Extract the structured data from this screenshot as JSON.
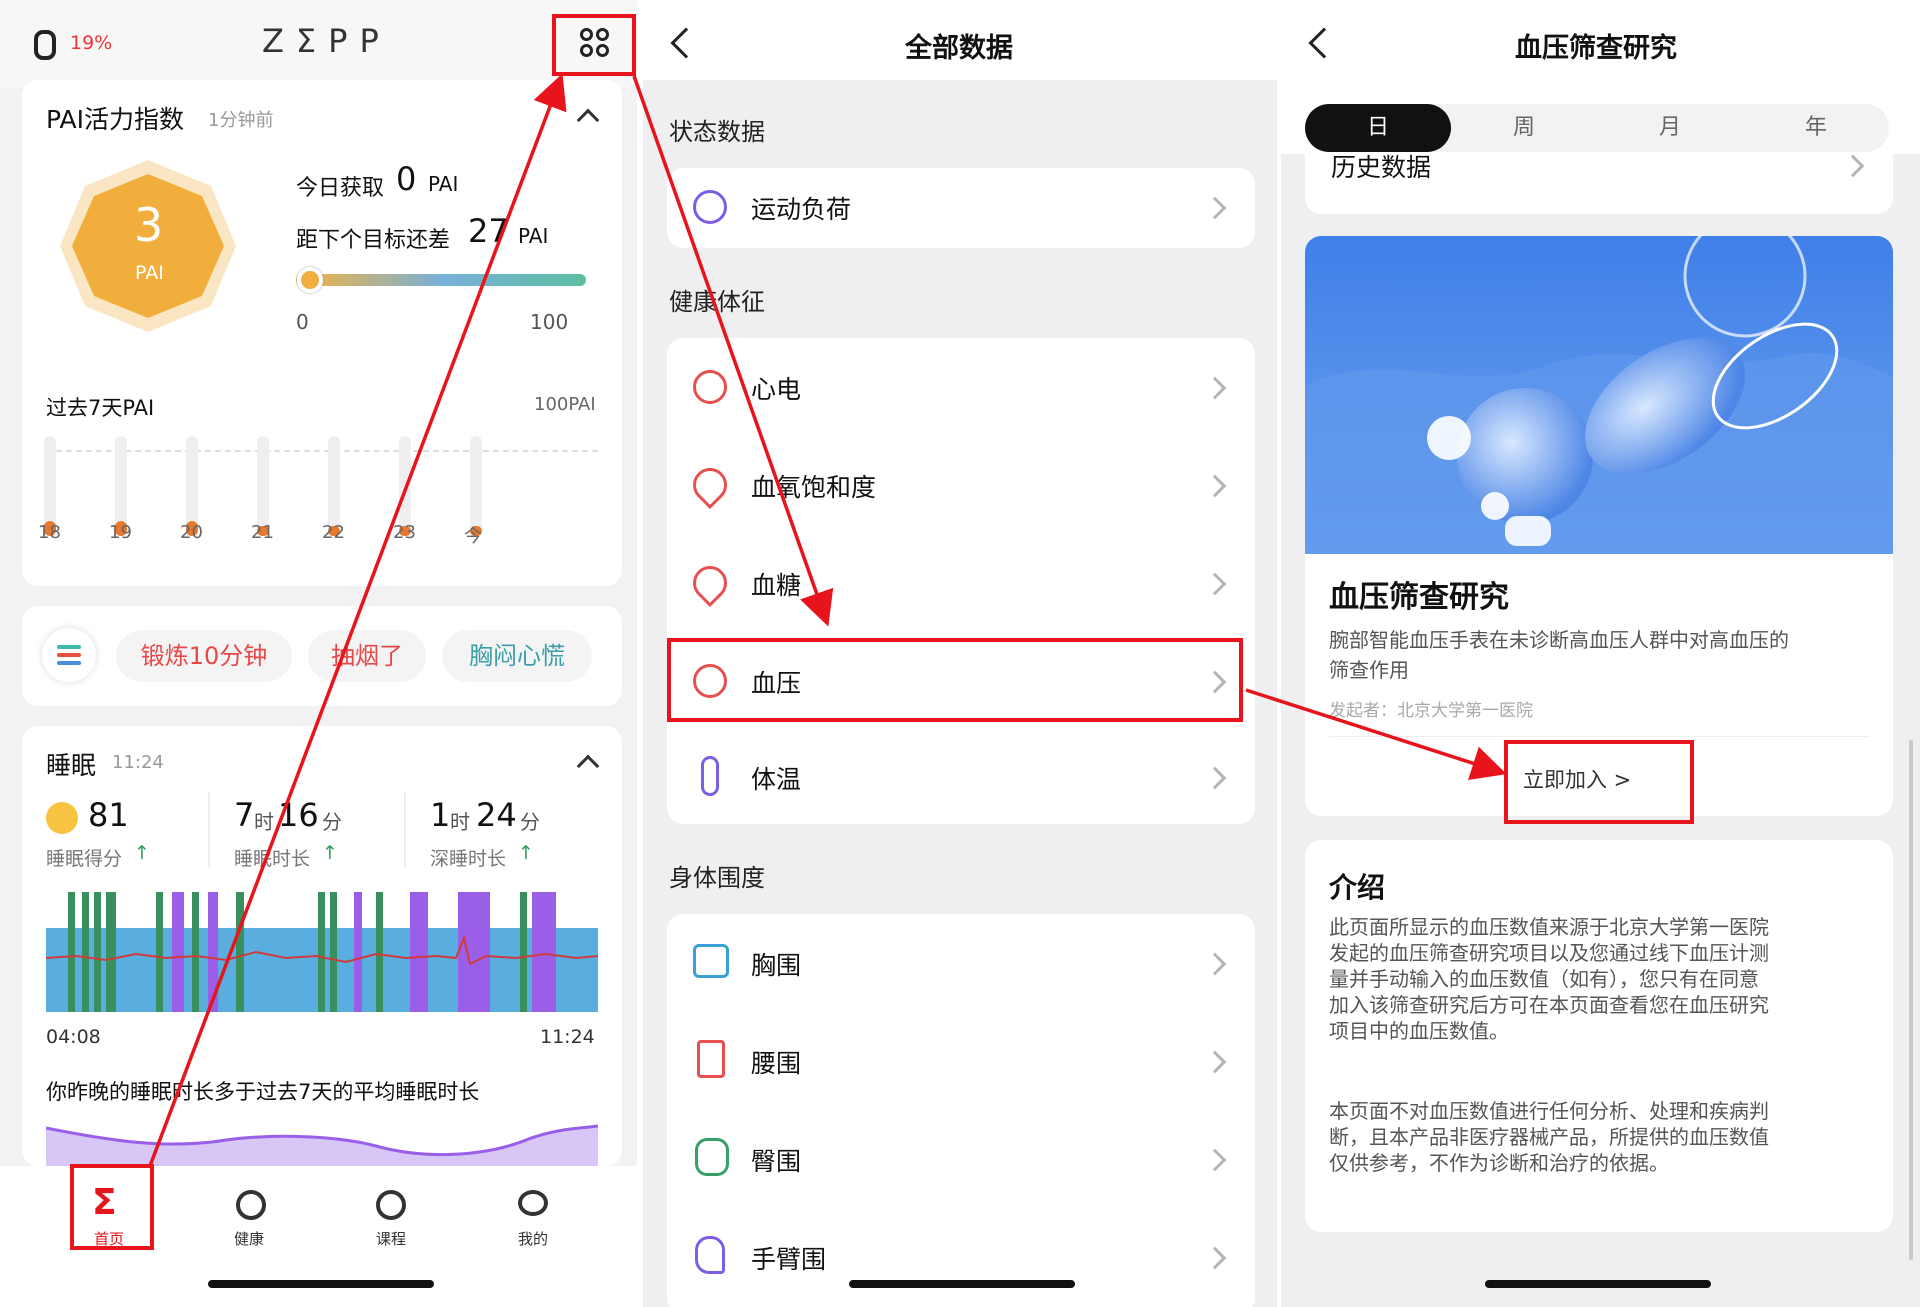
{
  "home": {
    "battery": "19%",
    "brand": "ZΣPP",
    "pai": {
      "title": "PAI活力指数",
      "time": "1分钟前",
      "value": "3",
      "unit": "PAI",
      "today_label": "今日获取",
      "today_value": "0",
      "today_unit": "PAI",
      "remain_label": "距下个目标还差",
      "remain_value": "27",
      "remain_unit": "PAI",
      "progress": 0.03,
      "min": "0",
      "max": "100",
      "week_title": "过去7天PAI",
      "week_max": "100PAI",
      "days": [
        "18",
        "19",
        "20",
        "21",
        "22",
        "23",
        "今"
      ],
      "values": [
        3,
        3,
        3,
        2,
        2,
        2,
        2
      ]
    },
    "tags": [
      "锻炼10分钟",
      "抽烟了",
      "胸闷心慌"
    ],
    "sleep": {
      "title": "睡眠",
      "time": "11:24",
      "score": "81",
      "score_label": "睡眠得分",
      "dur_h": "7",
      "dur_h_unit": "时",
      "dur_m": "16",
      "dur_m_unit": "分",
      "dur_label": "睡眠时长",
      "deep_h": "1",
      "deep_h_unit": "时",
      "deep_m": "24",
      "deep_m_unit": "分",
      "deep_label": "深睡时长",
      "start": "04:08",
      "end": "11:24",
      "note": "你昨晚的睡眠时长多于过去7天的平均睡眠时长"
    },
    "nav": [
      "首页",
      "健康",
      "课程",
      "我的"
    ]
  },
  "all_data": {
    "title": "全部数据",
    "section1": "状态数据",
    "item_load": "运动负荷",
    "section2": "健康体征",
    "vitals": [
      "心电",
      "血氧饱和度",
      "血糖",
      "血压",
      "体温"
    ],
    "section3": "身体围度",
    "body": [
      "胸围",
      "腰围",
      "臀围",
      "手臂围"
    ]
  },
  "bp": {
    "title": "血压筛查研究",
    "tabs": [
      "日",
      "周",
      "月",
      "年"
    ],
    "history": "历史数据",
    "study_title": "血压筛查研究",
    "study_desc_1": "腕部智能血压手表在未诊断高血压人群中对高血压的",
    "study_desc_2": "筛查作用",
    "sponsor": "发起者：北京大学第一医院",
    "join": "立即加入 >",
    "intro_title": "介绍",
    "intro_p1": [
      "此页面所显示的血压数值来源于北京大学第一医院",
      "发起的血压筛查研究项目以及您通过线下血压计测",
      "量并手动输入的血压数值（如有），您只有在同意",
      "加入该筛查研究后方可在本页面查看您在血压研究",
      "项目中的血压数值。"
    ],
    "intro_p2": [
      "本页面不对血压数值进行任何分析、处理和疾病判",
      "断，且本产品非医疗器械产品，所提供的血压数值",
      "仅供参考，不作为诊断和治疗的依据。"
    ]
  },
  "colors": {
    "accent_red": "#e8141b",
    "pai_orange": "#f2ae3c",
    "deep_sleep": "#3a8f5e",
    "rem": "#9a5ee8",
    "light": "#5aaedf"
  }
}
